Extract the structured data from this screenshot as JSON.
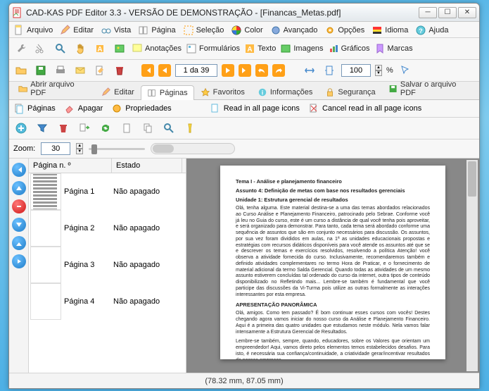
{
  "window": {
    "title": "CAD-KAS PDF Editor 3.3 - VERSÃO DE DEMONSTRAÇÃO - [Financas_Metas.pdf]"
  },
  "menus": {
    "arquivo": "Arquivo",
    "editar": "Editar",
    "vista": "Vista",
    "pagina": "Página",
    "selecao": "Seleção",
    "color": "Color",
    "avancado": "Avançado",
    "opcoes": "Opções",
    "idioma": "Idioma",
    "ajuda": "Ajuda"
  },
  "toolbar2": {
    "anotacoes": "Anotações",
    "formularios": "Formulários",
    "texto": "Texto",
    "imagens": "Imagens",
    "graficos": "Gráficos",
    "marcas": "Marcas"
  },
  "nav": {
    "page_display": "1 da 39",
    "zoom_value": "100",
    "percent": "%"
  },
  "tabs": {
    "abrir": "Abrir arquivo PDF",
    "editar": "Editar",
    "paginas": "Páginas",
    "favoritos": "Favoritos",
    "informacoes": "Informações",
    "seguranca": "Segurança",
    "salvar": "Salvar o arquivo PDF"
  },
  "subtoolbar": {
    "paginas": "Páginas",
    "apagar": "Apagar",
    "propriedades": "Propriedades",
    "readall": "Read in all page icons",
    "cancelread": "Cancel read in all page icons"
  },
  "zoomrow": {
    "label": "Zoom:",
    "value": "30"
  },
  "pagelist": {
    "col1": "Página n. º",
    "col2": "Estado",
    "rows": [
      {
        "label": "Página 1",
        "state": "Não apagado"
      },
      {
        "label": "Página 2",
        "state": "Não apagado"
      },
      {
        "label": "Página 3",
        "state": "Não apagado"
      },
      {
        "label": "Página 4",
        "state": "Não apagado"
      }
    ]
  },
  "doc": {
    "h1": "Tema I - Análise e planejamento financeiro",
    "h2": "Assunto 4: Definição de metas com base nos resultados gerenciais",
    "h3": "Unidade 1: Estrutura gerencial de resultados",
    "p1": "Olá, tenha alguma. Este material destina-se a uma das temas abordados relacionados ao Curso Análise e Planejamento Financeiro, patrocinado pelo Sebrae. Conforme você já leu no Guia do curso, este é um curso a distância de qual você tenha pois aproveitar, e será organizado para demonstrar. Para tanto, cada tema será abordado conforme uma sequência de assuntos que são em conjunto necessários para discussão. Os assuntos, por sua vez foram divididos em aulas, na 1ª as unidades educacionais propostas e estratégias com recursos didáticos disponíveis para você atende os assuntos até que se e descrever os temas e exercícios resolvidos, resolvendo a política Atenção! você observa a atividade fornecida do curso. Inclusivamente, recomendaremos também e definido atividades complementares no termo Hora de Praticar, e o fornecimento de material adicional da termo Salda Gerencial. Quando todas as atividades de um mesmo assunto estiverem concluídas tal ordenado do curso da internet, outra tipos de conteúdo disponibilizado no Refletindo mais... Lembre-se também é fundamental que você participe das discussões da Vi-Turma pois utilize as outras formalmente as interações interessantes por esta empresa.",
    "h4": "APRESENTAÇÃO PANORÂMICA",
    "p2": "Olá, amigos. Como tem passado? É bom continuar esses cursos com vocês! Destes chegando agora vamos iniciar do nosso curso da Análise e Planejamento Financeiro. Aqui é a primeira das quatro unidades que estudamos neste módulo. Nela vamos falar intensamente a Estrutura Gerencial de Resultados.",
    "p3": "Lembre-se também, sempre, quando, educadores, sobre os Valores que orientam um empreendedor! Aqui, vamos direto pelos elementos temos estabelecidos desafios. Para isto, é necessária sua confiança/continuidade, a criatividade gerar/incentivar resultados de nossas empresas."
  },
  "statusbar": {
    "coords": "(78.32 mm, 87.05 mm)"
  },
  "colors": {
    "orange": "#ff9c16",
    "blue": "#3590d8"
  }
}
